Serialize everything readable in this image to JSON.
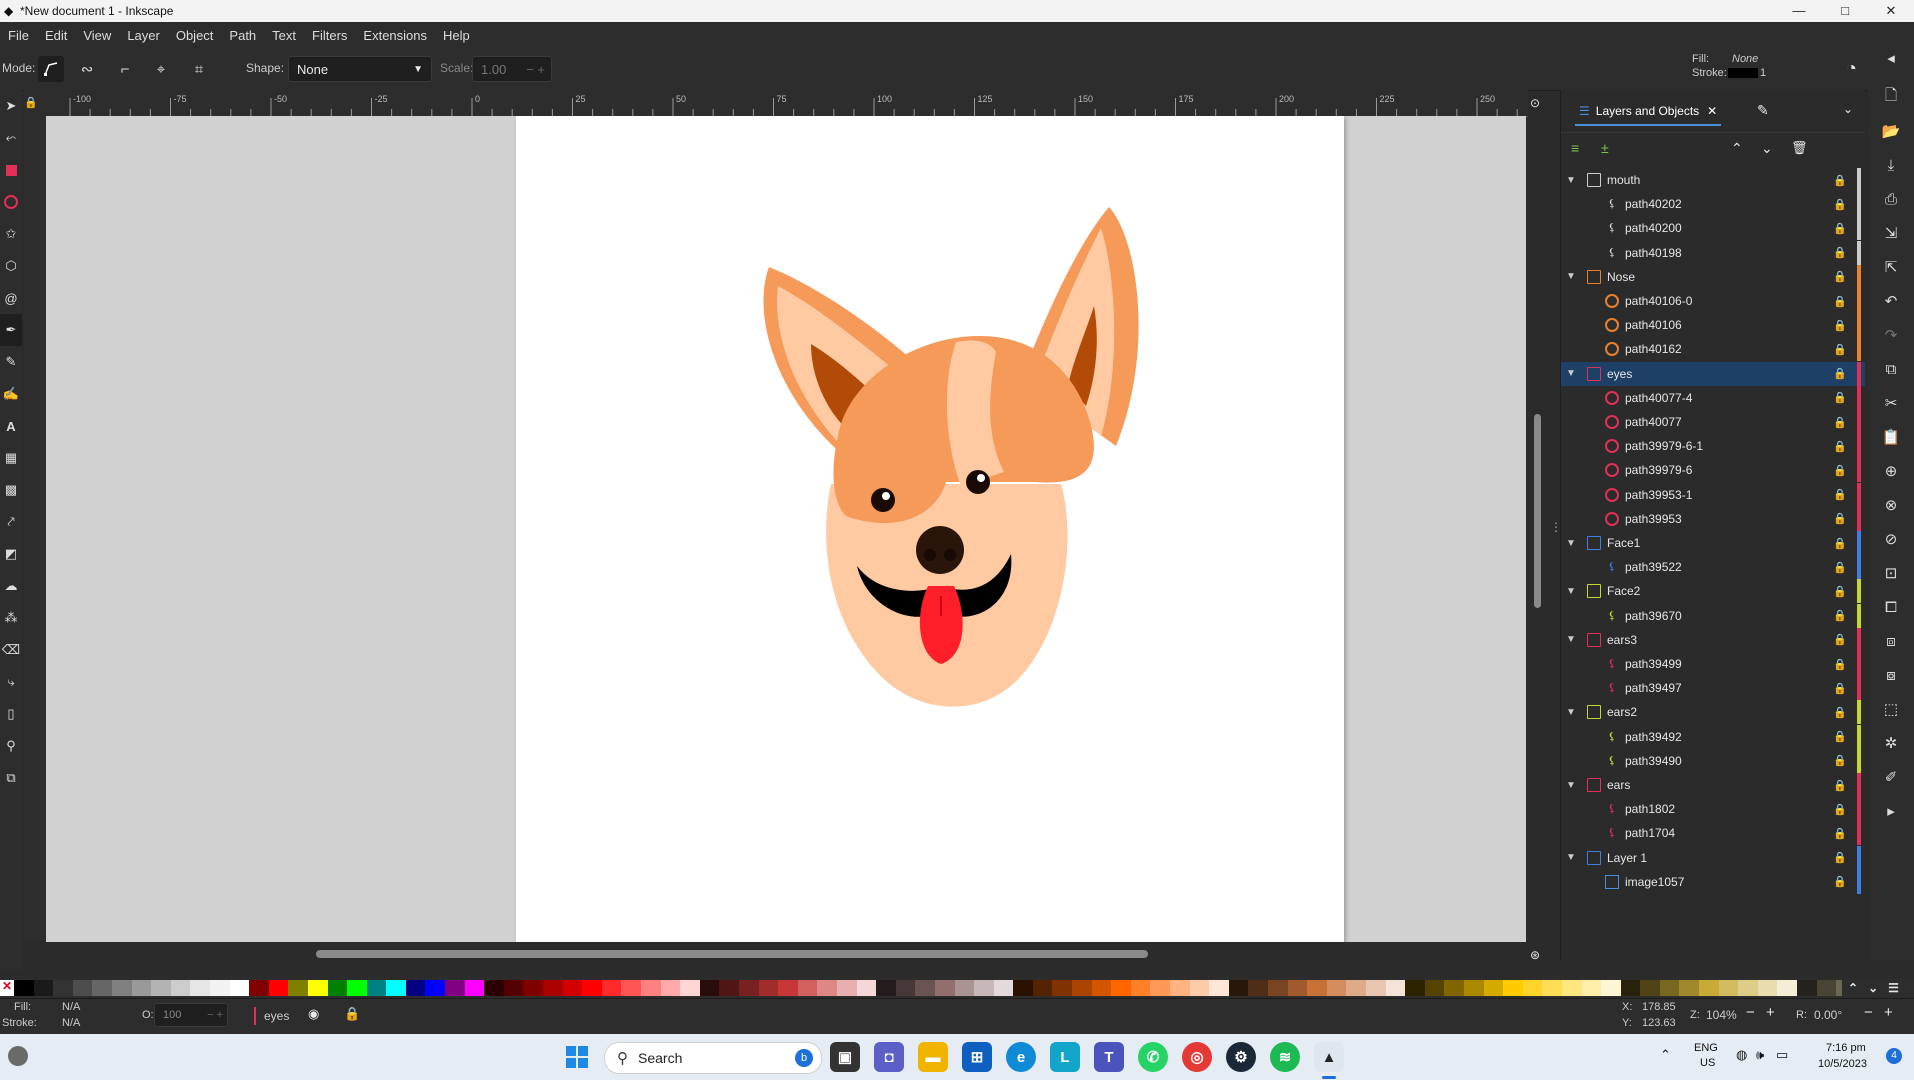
{
  "window": {
    "title": "*New document 1 - Inkscape",
    "minimize": "—",
    "maximize": "□",
    "close": "✕"
  },
  "menu": [
    "File",
    "Edit",
    "View",
    "Layer",
    "Object",
    "Path",
    "Text",
    "Filters",
    "Extensions",
    "Help"
  ],
  "toolbar": {
    "mode_label": "Mode:",
    "shape_label": "Shape:",
    "shape_value": "None",
    "scale_label": "Scale:",
    "scale_value": "1.00",
    "fill_label": "Fill:",
    "fill_value": "None",
    "stroke_label": "Stroke:",
    "stroke_value": "1"
  },
  "ruler_labels": [
    "-100",
    "-75",
    "-50",
    "-25",
    "0",
    "25",
    "50",
    "75",
    "100",
    "125",
    "150",
    "175",
    "200",
    "225",
    "250"
  ],
  "dock": {
    "tab_label": "Layers and Objects",
    "layers": [
      {
        "name": "mouth",
        "type": "layer",
        "color": "#cccccc",
        "children": [
          {
            "name": "path40202",
            "type": "path"
          },
          {
            "name": "path40200",
            "type": "path"
          },
          {
            "name": "path40198",
            "type": "path"
          }
        ]
      },
      {
        "name": "Nose",
        "type": "layer",
        "color": "#e8812e",
        "children": [
          {
            "name": "path40106-0",
            "type": "circle"
          },
          {
            "name": "path40106",
            "type": "circle"
          },
          {
            "name": "path40162",
            "type": "circle"
          }
        ]
      },
      {
        "name": "eyes",
        "type": "layer",
        "color": "#e0305a",
        "selected": true,
        "children": [
          {
            "name": "path40077-4",
            "type": "circle"
          },
          {
            "name": "path40077",
            "type": "circle"
          },
          {
            "name": "path39979-6-1",
            "type": "circle"
          },
          {
            "name": "path39979-6",
            "type": "circle"
          },
          {
            "name": "path39953-1",
            "type": "circle"
          },
          {
            "name": "path39953",
            "type": "circle"
          }
        ]
      },
      {
        "name": "Face1",
        "type": "layer",
        "color": "#3f7ee0",
        "children": [
          {
            "name": "path39522",
            "type": "path"
          }
        ]
      },
      {
        "name": "Face2",
        "type": "layer",
        "color": "#c8d630",
        "children": [
          {
            "name": "path39670",
            "type": "path"
          }
        ]
      },
      {
        "name": "ears3",
        "type": "layer",
        "color": "#e0305a",
        "children": [
          {
            "name": "path39499",
            "type": "path"
          },
          {
            "name": "path39497",
            "type": "path"
          }
        ]
      },
      {
        "name": "ears2",
        "type": "layer",
        "color": "#c8d630",
        "children": [
          {
            "name": "path39492",
            "type": "path"
          },
          {
            "name": "path39490",
            "type": "path"
          }
        ]
      },
      {
        "name": "ears",
        "type": "layer",
        "color": "#e0305a",
        "children": [
          {
            "name": "path1802",
            "type": "path"
          },
          {
            "name": "path1704",
            "type": "path"
          }
        ]
      },
      {
        "name": "Layer 1",
        "type": "layer",
        "color": "#3f7ee0",
        "children": [
          {
            "name": "image1057",
            "type": "image"
          }
        ]
      }
    ]
  },
  "statusbar": {
    "fill_label": "Fill:",
    "fill_value": "N/A",
    "stroke_label": "Stroke:",
    "stroke_value": "N/A",
    "opacity_label": "O:",
    "opacity_value": "100",
    "current_layer": "eyes",
    "x_label": "X:",
    "x_value": "178.85",
    "y_label": "Y:",
    "y_value": "123.63",
    "zoom_label": "Z:",
    "zoom_value": "104%",
    "rotation_label": "R:",
    "rotation_value": "0.00°"
  },
  "taskbar": {
    "search_placeholder": "Search",
    "lang_top": "ENG",
    "lang_bottom": "US",
    "time": "7:16 pm",
    "date": "10/5/2023",
    "notif_count": "4"
  },
  "palette_colors": [
    "#000000",
    "#1a1a1a",
    "#333333",
    "#4d4d4d",
    "#666666",
    "#808080",
    "#999999",
    "#b3b3b3",
    "#cccccc",
    "#e6e6e6",
    "#f2f2f2",
    "#ffffff",
    "#800000",
    "#ff0000",
    "#808000",
    "#ffff00",
    "#008000",
    "#00ff00",
    "#008080",
    "#00ffff",
    "#000080",
    "#0000ff",
    "#800080",
    "#ff00ff",
    "#2b0000",
    "#550000",
    "#800000",
    "#aa0000",
    "#d40000",
    "#ff0000",
    "#ff2a2a",
    "#ff5555",
    "#ff8080",
    "#ffaaaa",
    "#ffd5d5",
    "#280b0b",
    "#501616",
    "#782121",
    "#a02c2c",
    "#c83737",
    "#d35f5f",
    "#de8787",
    "#e9afaf",
    "#f4d7d7",
    "#241c1c",
    "#483737",
    "#6c5353",
    "#916f6f",
    "#ac9393",
    "#c8b7b7",
    "#e3dbdb",
    "#2b1100",
    "#552200",
    "#803300",
    "#aa4400",
    "#d45500",
    "#ff6600",
    "#ff7f2a",
    "#ff9955",
    "#ffb380",
    "#ffccaa",
    "#ffe6d5",
    "#28170b",
    "#502d16",
    "#784421",
    "#a05a2c",
    "#c87137",
    "#d38d5f",
    "#deaa87",
    "#e9c6af",
    "#f4e3d7",
    "#2b2200",
    "#554400",
    "#806600",
    "#aa8800",
    "#d4aa00",
    "#ffcc00",
    "#ffd42a",
    "#ffdd55",
    "#ffe680",
    "#ffeeaa",
    "#fff6d5",
    "#28220b",
    "#504416",
    "#786721",
    "#a0892c",
    "#c8ab37",
    "#d3bc5f",
    "#decd87",
    "#e9ddaf",
    "#f4eed7",
    "#24221c",
    "#484537",
    "#6c6753",
    "#918a6f",
    "#aca793",
    "#c8c4b7"
  ]
}
